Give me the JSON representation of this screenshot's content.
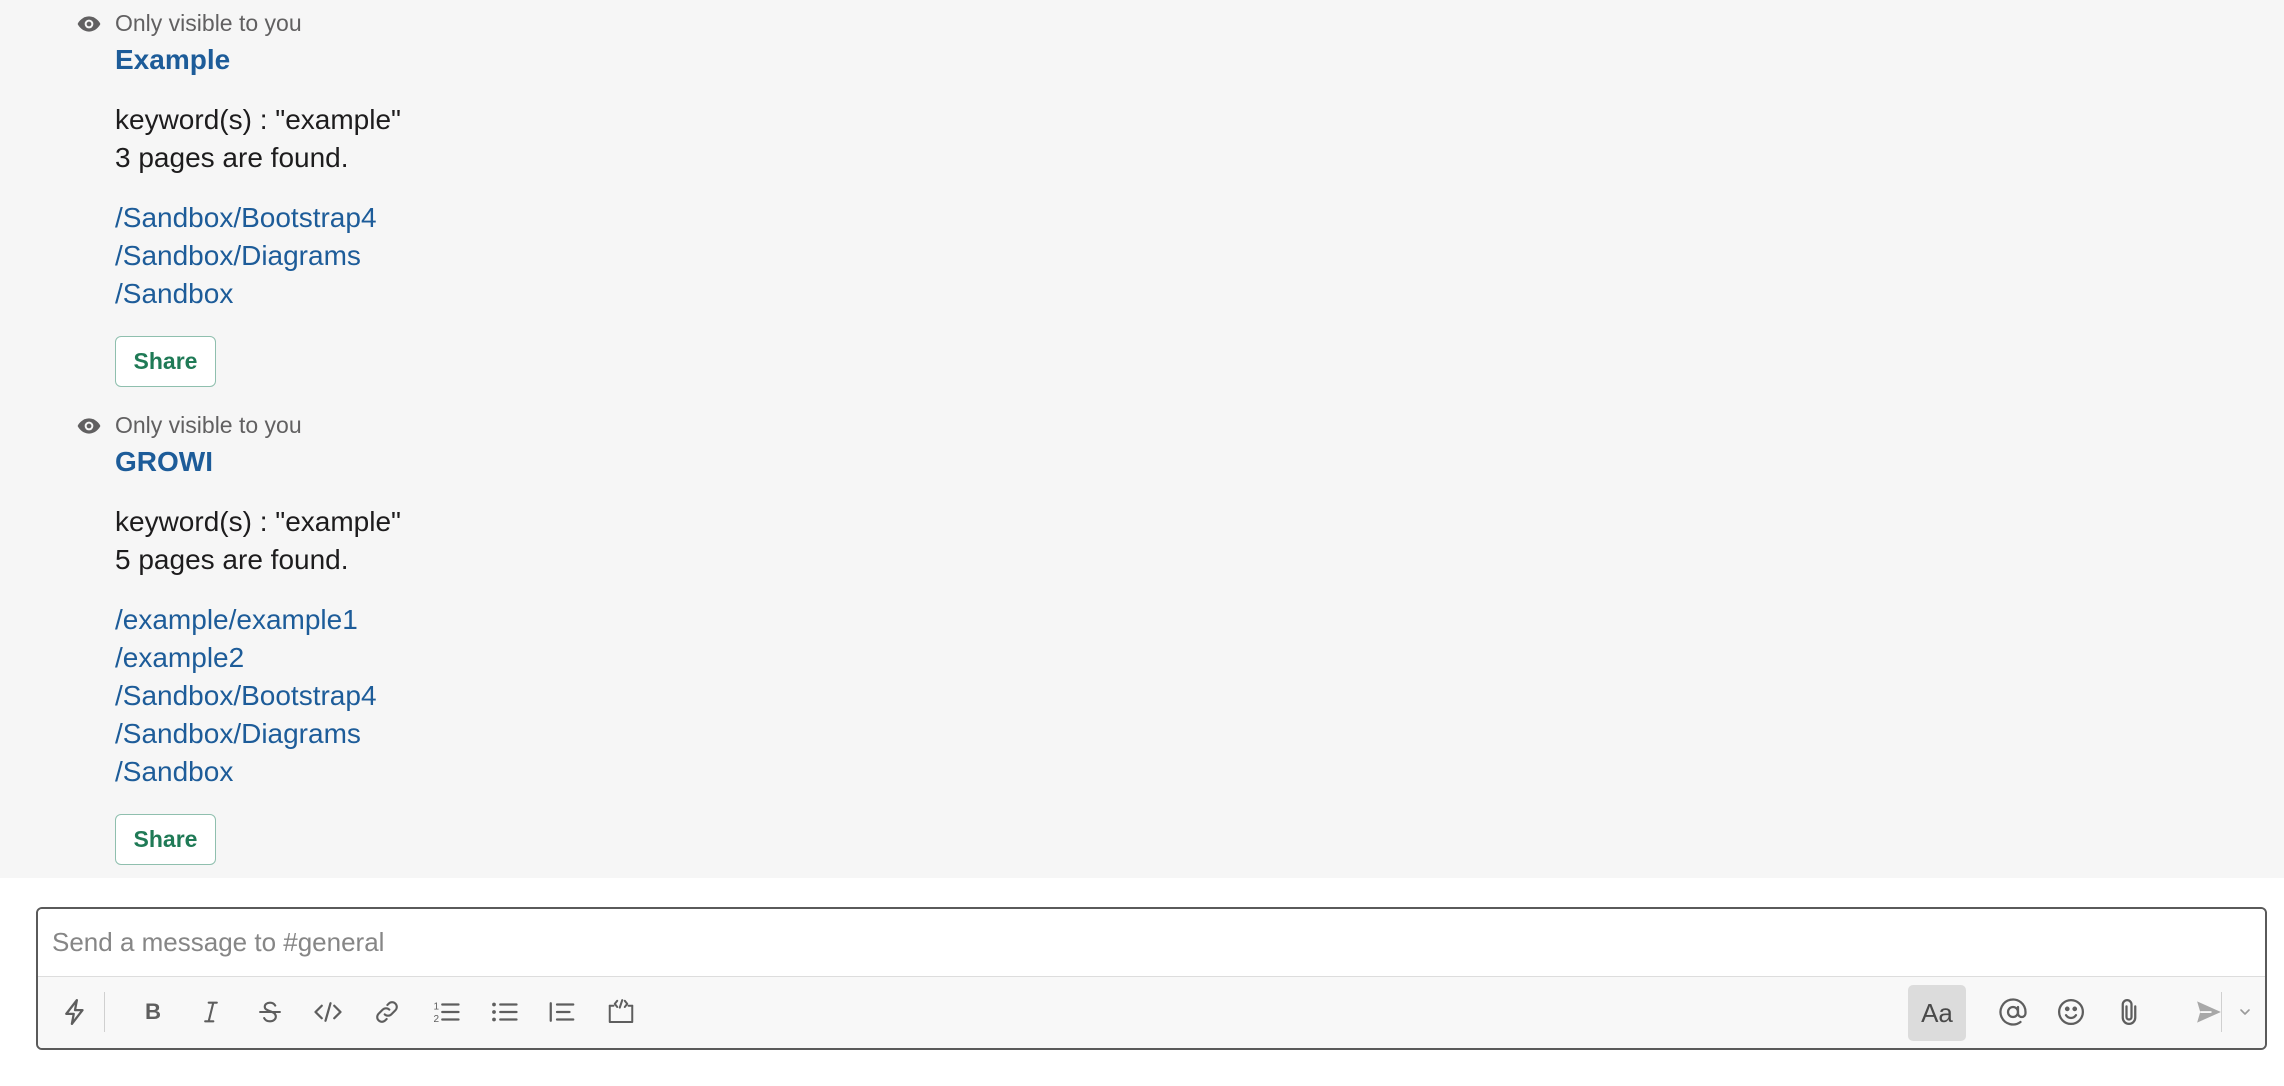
{
  "messages": [
    {
      "visibility": "Only visible to you",
      "title": "Example",
      "keywords": "keyword(s) : \"example\"",
      "found": "3 pages are found.",
      "links": [
        "/Sandbox/Bootstrap4",
        "/Sandbox/Diagrams",
        "/Sandbox"
      ],
      "share_label": "Share"
    },
    {
      "visibility": "Only visible to you",
      "title": "GROWI",
      "keywords": "keyword(s) : \"example\"",
      "found": "5 pages are found.",
      "links": [
        "/example/example1",
        "/example2",
        "/Sandbox/Bootstrap4",
        "/Sandbox/Diagrams",
        "/Sandbox"
      ],
      "share_label": "Share"
    }
  ],
  "composer": {
    "placeholder": "Send a message to #general",
    "value": "",
    "format_toggle_label": "Aa"
  },
  "icons": {
    "visibility": "eye-icon",
    "shortcuts": "lightning-icon",
    "bold": "bold-icon",
    "italic": "italic-icon",
    "strike": "strikethrough-icon",
    "code": "code-icon",
    "link": "link-icon",
    "ordered_list": "ordered-list-icon",
    "bulleted_list": "bulleted-list-icon",
    "blockquote": "blockquote-icon",
    "code_block": "code-block-icon",
    "mention": "at-mention-icon",
    "emoji": "emoji-icon",
    "attach": "paperclip-icon",
    "send": "send-icon",
    "send_options": "chevron-down-icon"
  },
  "colors": {
    "link": "#1d5c99",
    "share_text": "#1f7a56",
    "background": "#f6f6f6"
  }
}
